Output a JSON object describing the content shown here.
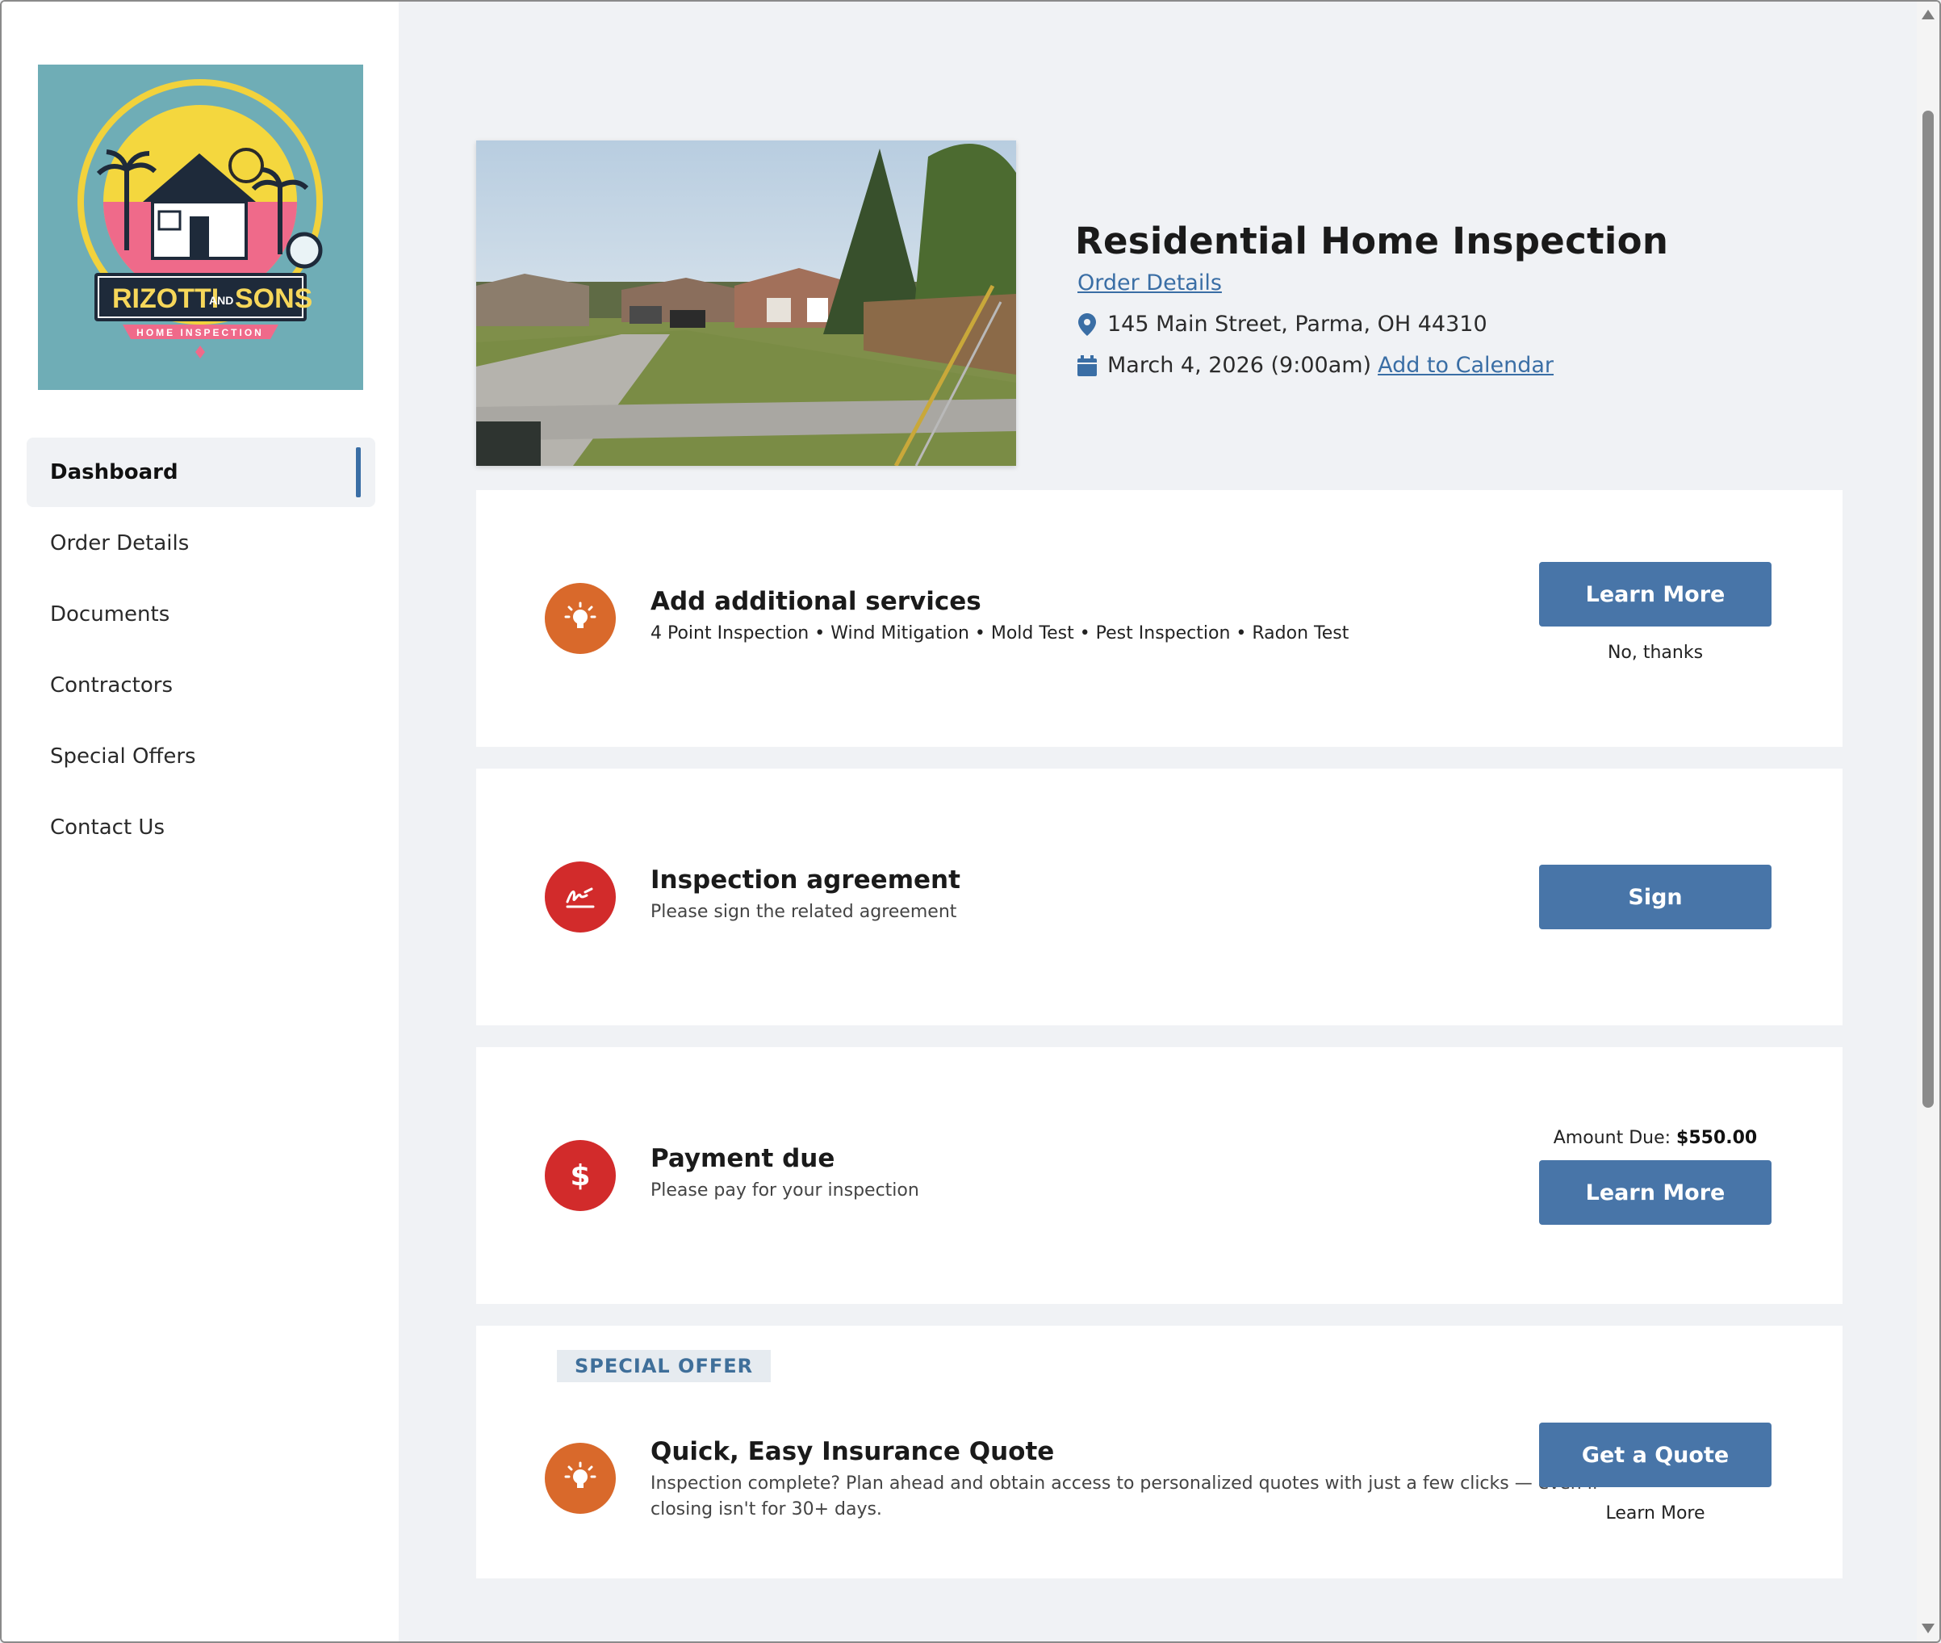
{
  "brand": {
    "logo_alt": "Rizotti and Sons Home Inspection logo",
    "logo_text_main": "RIZOTTI",
    "logo_text_and": "AND",
    "logo_text_sons": "SONS",
    "logo_text_sub": "HOME INSPECTION"
  },
  "nav": {
    "items": [
      {
        "label": "Dashboard",
        "active": true
      },
      {
        "label": "Order Details",
        "active": false
      },
      {
        "label": "Documents",
        "active": false
      },
      {
        "label": "Contractors",
        "active": false
      },
      {
        "label": "Special Offers",
        "active": false
      },
      {
        "label": "Contact Us",
        "active": false
      }
    ]
  },
  "header": {
    "title": "Residential Home Inspection",
    "order_details_link": "Order Details",
    "address": "145 Main Street, Parma, OH 44310",
    "date": "March 4, 2026 (9:00am)",
    "add_calendar_link": "Add to Calendar",
    "icons": {
      "address": "map-pin-icon",
      "date": "calendar-icon"
    }
  },
  "cards": {
    "services": {
      "icon": "lightbulb-icon",
      "title": "Add additional services",
      "subtitle": "4 Point Inspection • Wind Mitigation • Mold Test • Pest Inspection • Radon Test",
      "primary_button": "Learn More",
      "secondary_action": "No, thanks"
    },
    "agreement": {
      "icon": "signature-icon",
      "title": "Inspection agreement",
      "subtitle": "Please sign the related agreement",
      "primary_button": "Sign"
    },
    "payment": {
      "icon": "dollar-icon",
      "title": "Payment due",
      "subtitle": "Please pay for your inspection",
      "amount_label": "Amount Due:",
      "amount_value": "$550.00",
      "primary_button": "Learn More"
    },
    "offer": {
      "badge": "SPECIAL OFFER",
      "icon": "lightbulb-icon",
      "title": "Quick, Easy Insurance Quote",
      "subtitle_line1": "Inspection complete? Plan ahead and obtain access to personalized quotes with just a few clicks — even if",
      "subtitle_line2": "closing isn't for 30+ days.",
      "primary_button": "Get a Quote",
      "secondary_action": "Learn More"
    }
  },
  "colors": {
    "accent": "#4875a8",
    "link": "#3a6ea5",
    "icon_orange": "#d9692b",
    "icon_red": "#d22b2b",
    "background": "#f0f2f5",
    "logo_bg": "#6fadb6"
  }
}
